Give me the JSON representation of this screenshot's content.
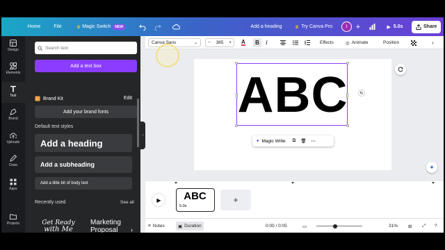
{
  "topbar": {
    "home": "Home",
    "file": "File",
    "magic_switch": "Magic Switch",
    "new_badge": "NEW",
    "doc_title": "Add a heading",
    "try_pro": "Try Canva Pro",
    "avatar_initial": "I",
    "duration": "5.0s",
    "share": "Share"
  },
  "rail": {
    "items": [
      {
        "label": "Design",
        "icon": "design-icon"
      },
      {
        "label": "Elements",
        "icon": "elements-icon"
      },
      {
        "label": "Text",
        "icon": "text-icon"
      },
      {
        "label": "Brand",
        "icon": "brand-icon"
      },
      {
        "label": "Uploads",
        "icon": "upload-icon"
      },
      {
        "label": "Draw",
        "icon": "draw-icon"
      },
      {
        "label": "Apps",
        "icon": "apps-icon"
      },
      {
        "label": "Projects",
        "icon": "folder-icon"
      }
    ]
  },
  "panel": {
    "search_placeholder": "Search text",
    "add_text_box": "Add a text box",
    "brand_kit": "Brand Kit",
    "brand_kit_edit": "Edit",
    "add_brand_fonts": "Add your brand fonts",
    "default_styles": "Default text styles",
    "heading": "Add a heading",
    "subheading": "Add a subheading",
    "body": "Add a little bit of body text",
    "recently_used": "Recently used",
    "see_all": "See all",
    "recent1_line1": "Get Ready",
    "recent1_line2": "with Me",
    "recent2_line1": "Marketing",
    "recent2_line2": "Proposal"
  },
  "toolbar": {
    "font": "Canva Sans",
    "size": "385",
    "effects": "Effects",
    "animate": "Animate",
    "position": "Position"
  },
  "canvas": {
    "text": "ABC",
    "magic_write": "Magic Write"
  },
  "timeline": {
    "clip_text": "ABC",
    "clip_duration": "5.0s"
  },
  "footer": {
    "notes": "Notes",
    "duration": "Duration",
    "time": "0:00 / 0:05",
    "zoom": "31%"
  },
  "colors": {
    "accent": "#8b3dff",
    "topbar_start": "#1aa7c5",
    "topbar_end": "#6a3fd6"
  }
}
